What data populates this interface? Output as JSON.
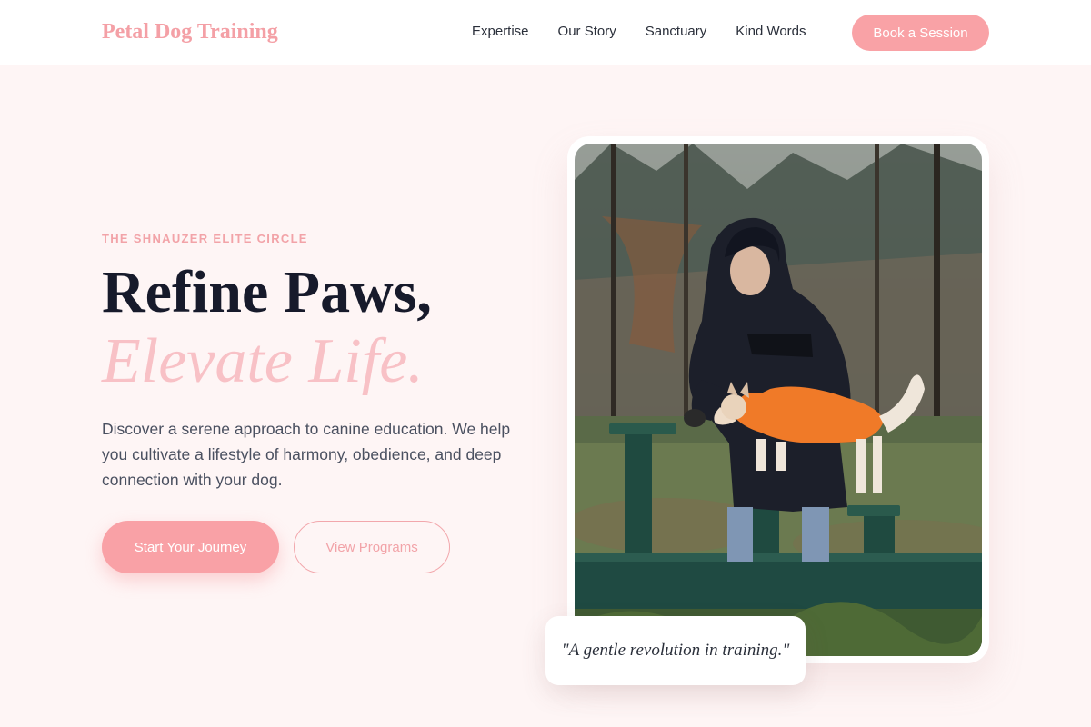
{
  "nav": {
    "brand": "Petal Dog Training",
    "links": [
      "Expertise",
      "Our Story",
      "Sanctuary",
      "Kind Words"
    ],
    "cta": "Book a Session"
  },
  "hero": {
    "eyebrow": "THE SHNAUZER ELITE CIRCLE",
    "headline": "Refine Paws,",
    "headline_accent": "Elevate Life.",
    "description": "Discover a serene approach to canine education. We help you cultivate a lifestyle of harmony, obedience, and deep connection with your dog.",
    "primary_button": "Start Your Journey",
    "secondary_button": "View Programs"
  },
  "photo": {
    "subject": "trainer-with-dog-in-orange-coat-on-agility-posts"
  },
  "quote": {
    "text": "\"A gentle revolution in training.\""
  },
  "colors": {
    "brand_pink": "#f4a0a6",
    "button_pink": "#f9a1a6",
    "accent_italic": "#f8c1c6",
    "page_background": "#fef5f5",
    "headline_dark": "#171a2b"
  }
}
